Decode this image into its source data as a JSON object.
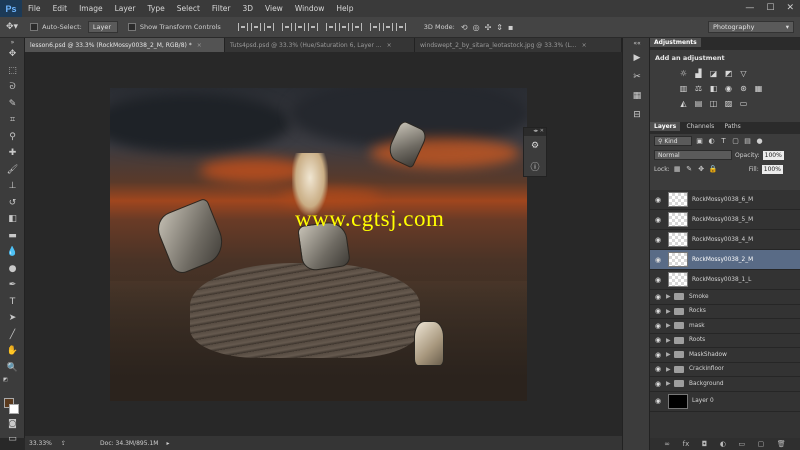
{
  "menubar": {
    "logo": "Ps",
    "items": [
      "File",
      "Edit",
      "Image",
      "Layer",
      "Type",
      "Select",
      "Filter",
      "3D",
      "View",
      "Window",
      "Help"
    ],
    "win_min": "—",
    "win_max": "☐",
    "win_close": "✕"
  },
  "options": {
    "auto_select_label": "Auto-Select:",
    "auto_select_value": "Layer",
    "transform_label": "Show Transform Controls",
    "mode_label": "3D Mode:",
    "workspace": "Photography"
  },
  "tabs": [
    {
      "label": "lesson6.psd @ 33.3% (RockMossy0038_2_M, RGB/8) *",
      "close": "×",
      "active": true
    },
    {
      "label": "Tuts4psd.psd @ 33.3% (Hue/Saturation 6, Layer ...",
      "close": "×",
      "active": false
    },
    {
      "label": "windswept_2_by_sitara_leotastock.jpg @ 33.3% (L...",
      "close": "×",
      "active": false
    }
  ],
  "canvas": {
    "watermark": "www.cgtsj.com"
  },
  "status": {
    "zoom": "33.33%",
    "doc_info": "Doc: 34.3M/895.1M"
  },
  "adjustments": {
    "tab": "Adjustments",
    "title": "Add an adjustment"
  },
  "layers_panel": {
    "tabs": [
      "Layers",
      "Channels",
      "Paths"
    ],
    "filter_kind": "Kind",
    "blend_mode": "Normal",
    "opacity_label": "Opacity:",
    "opacity_value": "100%",
    "lock_label": "Lock:",
    "fill_label": "Fill:",
    "fill_value": "100%",
    "layers": [
      {
        "name": "RockMossy0038_6_M",
        "type": "layer",
        "selected": false
      },
      {
        "name": "RockMossy0038_5_M",
        "type": "layer",
        "selected": false
      },
      {
        "name": "RockMossy0038_4_M",
        "type": "layer",
        "selected": false
      },
      {
        "name": "RockMossy0038_2_M",
        "type": "layer",
        "selected": true
      },
      {
        "name": "RockMossy0038_1_L",
        "type": "layer",
        "selected": false
      },
      {
        "name": "Smoke",
        "type": "group",
        "selected": false
      },
      {
        "name": "Rocks",
        "type": "group",
        "selected": false
      },
      {
        "name": "mask",
        "type": "group",
        "selected": false
      },
      {
        "name": "Roots",
        "type": "group",
        "selected": false
      },
      {
        "name": "MaskShadow",
        "type": "group",
        "selected": false
      },
      {
        "name": "Crackinfloor",
        "type": "group",
        "selected": false
      },
      {
        "name": "Background",
        "type": "group",
        "selected": false
      },
      {
        "name": "Layer 0",
        "type": "fill-black",
        "selected": false
      }
    ],
    "footer_icons": [
      "link-icon",
      "fx-icon",
      "mask-icon",
      "adjustment-icon",
      "group-icon",
      "new-layer-icon",
      "trash-icon"
    ]
  }
}
